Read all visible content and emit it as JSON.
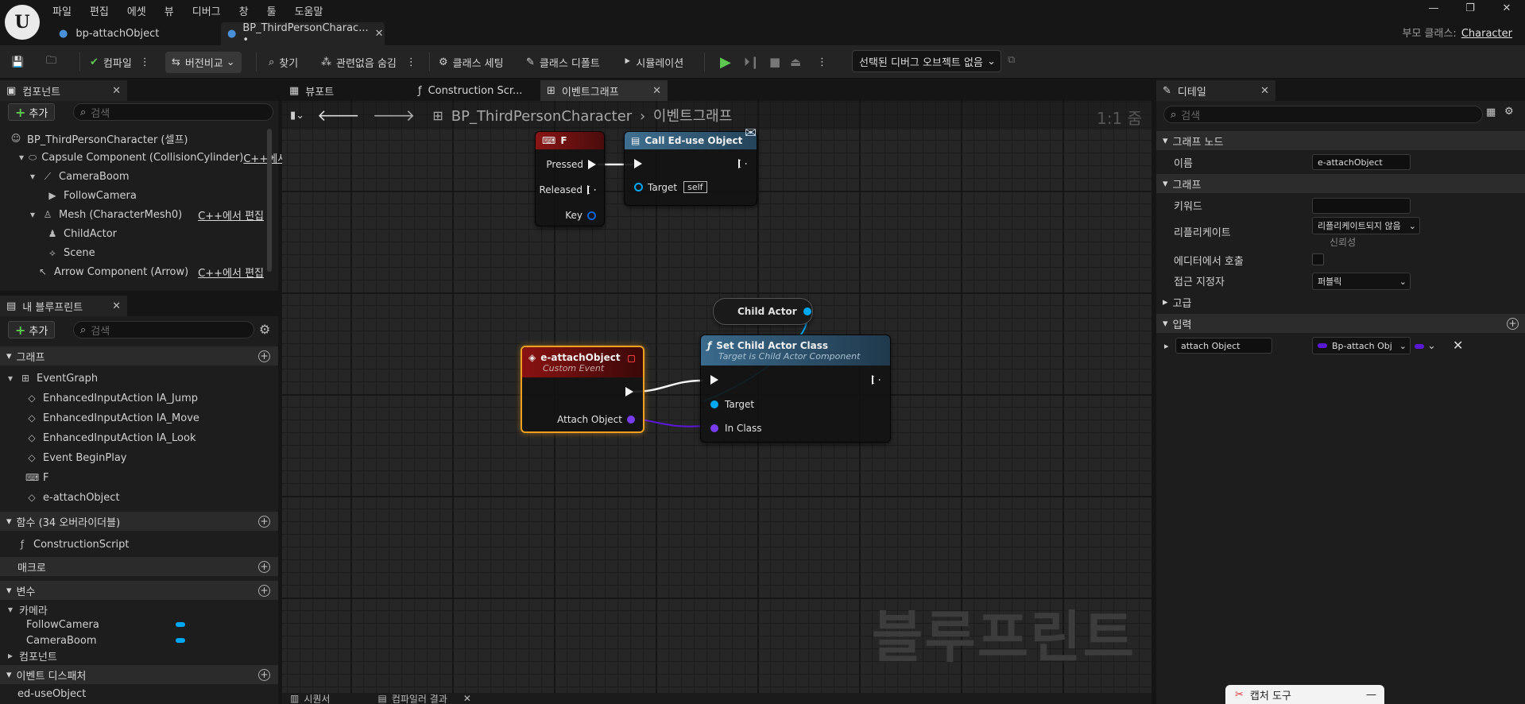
{
  "menu": [
    "파일",
    "편집",
    "에셋",
    "뷰",
    "디버그",
    "창",
    "툴",
    "도움말"
  ],
  "doc_tabs": [
    "bp-attachObject",
    "BP_ThirdPersonCharac... •"
  ],
  "parent_class": {
    "label": "부모 클래스:",
    "value": "Character"
  },
  "toolbar": {
    "compile": "컴파일",
    "diff": "버전비교",
    "find": "찾기",
    "hide_unrelated": "관련없음 숨김",
    "class_settings": "클래스 세팅",
    "class_defaults": "클래스 디폴트",
    "simulation": "시뮬레이션",
    "debug_object": "선택된 디버그 오브젝트 없음"
  },
  "components": {
    "tab": "컴포넌트",
    "add": "추가",
    "search_placeholder": "검색",
    "items": [
      {
        "label": "BP_ThirdPersonCharacter (셀프)",
        "edit": ""
      },
      {
        "label": "Capsule Component (CollisionCylinder)",
        "edit": "C++에서"
      },
      {
        "label": "CameraBoom",
        "edit": ""
      },
      {
        "label": "FollowCamera",
        "edit": ""
      },
      {
        "label": "Mesh (CharacterMesh0)",
        "edit": "C++에서 편집"
      },
      {
        "label": "ChildActor",
        "edit": ""
      },
      {
        "label": "Scene",
        "edit": ""
      },
      {
        "label": "Arrow Component (Arrow)",
        "edit": "C++에서 편집"
      }
    ]
  },
  "my_blueprint": {
    "tab": "내 블루프린트",
    "add": "추가",
    "search_placeholder": "검색",
    "graph_section": "그래프",
    "event_graph": "EventGraph",
    "events": [
      "EnhancedInputAction IA_Jump",
      "EnhancedInputAction IA_Move",
      "EnhancedInputAction IA_Look",
      "Event BeginPlay",
      "F",
      "e-attachObject"
    ],
    "functions_section": "함수 (34 오버라이더블)",
    "functions": [
      "ConstructionScript"
    ],
    "macros_section": "매크로",
    "variables_section": "변수",
    "variable_category": "카메라",
    "variables": [
      "FollowCamera",
      "CameraBoom"
    ],
    "component_category": "컴포넌트",
    "dispatchers_section": "이벤트 디스패처",
    "dispatchers": [
      "ed-useObject"
    ]
  },
  "editor_tabs": [
    "뷰포트",
    "Construction Scr...",
    "이벤트그래프"
  ],
  "graph": {
    "breadcrumb_root": "BP_ThirdPersonCharacter",
    "breadcrumb_leaf": "이벤트그래프",
    "zoom": "1:1 줌",
    "watermark": "블루프린트",
    "nodes": {
      "f_key": {
        "title": "F",
        "pins": [
          "Pressed",
          "Released",
          "Key"
        ]
      },
      "call": {
        "title": "Call Ed-use Object",
        "target": "Target",
        "self": "self"
      },
      "child_actor": {
        "title": "Child Actor"
      },
      "custom_event": {
        "title": "e-attachObject",
        "subtitle": "Custom Event",
        "pin": "Attach Object"
      },
      "set_class": {
        "title": "Set Child Actor Class",
        "subtitle": "Target is Child Actor Component",
        "pins": [
          "Target",
          "In Class"
        ]
      }
    }
  },
  "bottom_tabs": [
    "시퀀서",
    "컴파일러 결과"
  ],
  "capture_tool": "캡처 도구",
  "details": {
    "tab": "디테일",
    "search_placeholder": "검색",
    "graph_node_section": "그래프 노드",
    "name_label": "이름",
    "name_value": "e-attachObject",
    "graph_section": "그래프",
    "keyword_label": "키워드",
    "replicate_label": "리플리케이트",
    "replicate_value": "리플리케이트되지 않음",
    "reliable_label": "신뢰성",
    "call_in_editor_label": "에디터에서 호출",
    "access_label": "접근 지정자",
    "access_value": "퍼블릭",
    "advanced_section": "고급",
    "inputs_section": "입력",
    "input_name": "attach Object",
    "input_type": "Bp-attach Obj"
  },
  "colors": {
    "exec": "#f5f5f5",
    "object_pin": "#00a8f3",
    "class_pin": "#5a18d6",
    "event_header": "#7d1010",
    "function_header": "#1c4a6e"
  }
}
